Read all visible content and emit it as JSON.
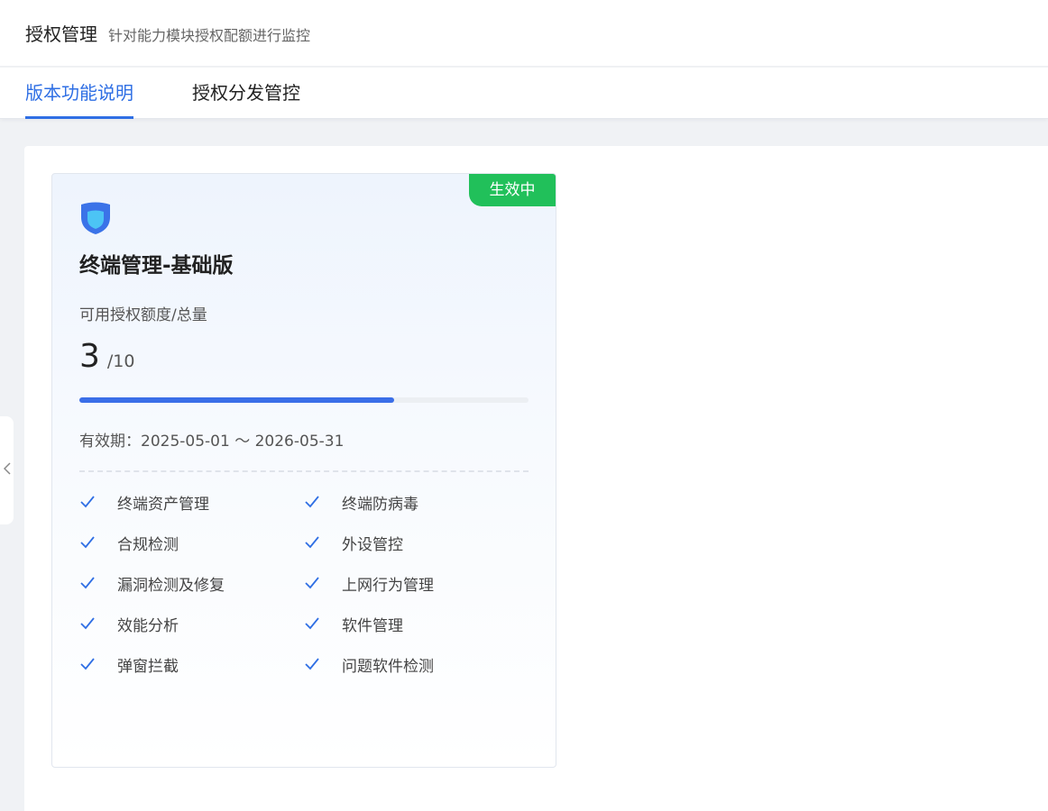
{
  "header": {
    "title": "授权管理",
    "subtitle": "针对能力模块授权配额进行监控"
  },
  "tabs": [
    {
      "label": "版本功能说明",
      "active": true
    },
    {
      "label": "授权分发管控",
      "active": false
    }
  ],
  "colors": {
    "accent": "#2f6fe4",
    "status_active": "#21c05a",
    "progress": "#3a6ee8"
  },
  "card": {
    "status": "生效中",
    "icon": "shield-icon",
    "title": "终端管理-基础版",
    "quota_label": "可用授权额度/总量",
    "available": "3",
    "total": "/10",
    "progress_fraction": 0.7,
    "validity": "有效期：2025-05-01 ～ 2026-05-31",
    "features": [
      "终端资产管理",
      "终端防病毒",
      "合规检测",
      "外设管控",
      "漏洞检测及修复",
      "上网行为管理",
      "效能分析",
      "软件管理",
      "弹窗拦截",
      "问题软件检测"
    ]
  }
}
